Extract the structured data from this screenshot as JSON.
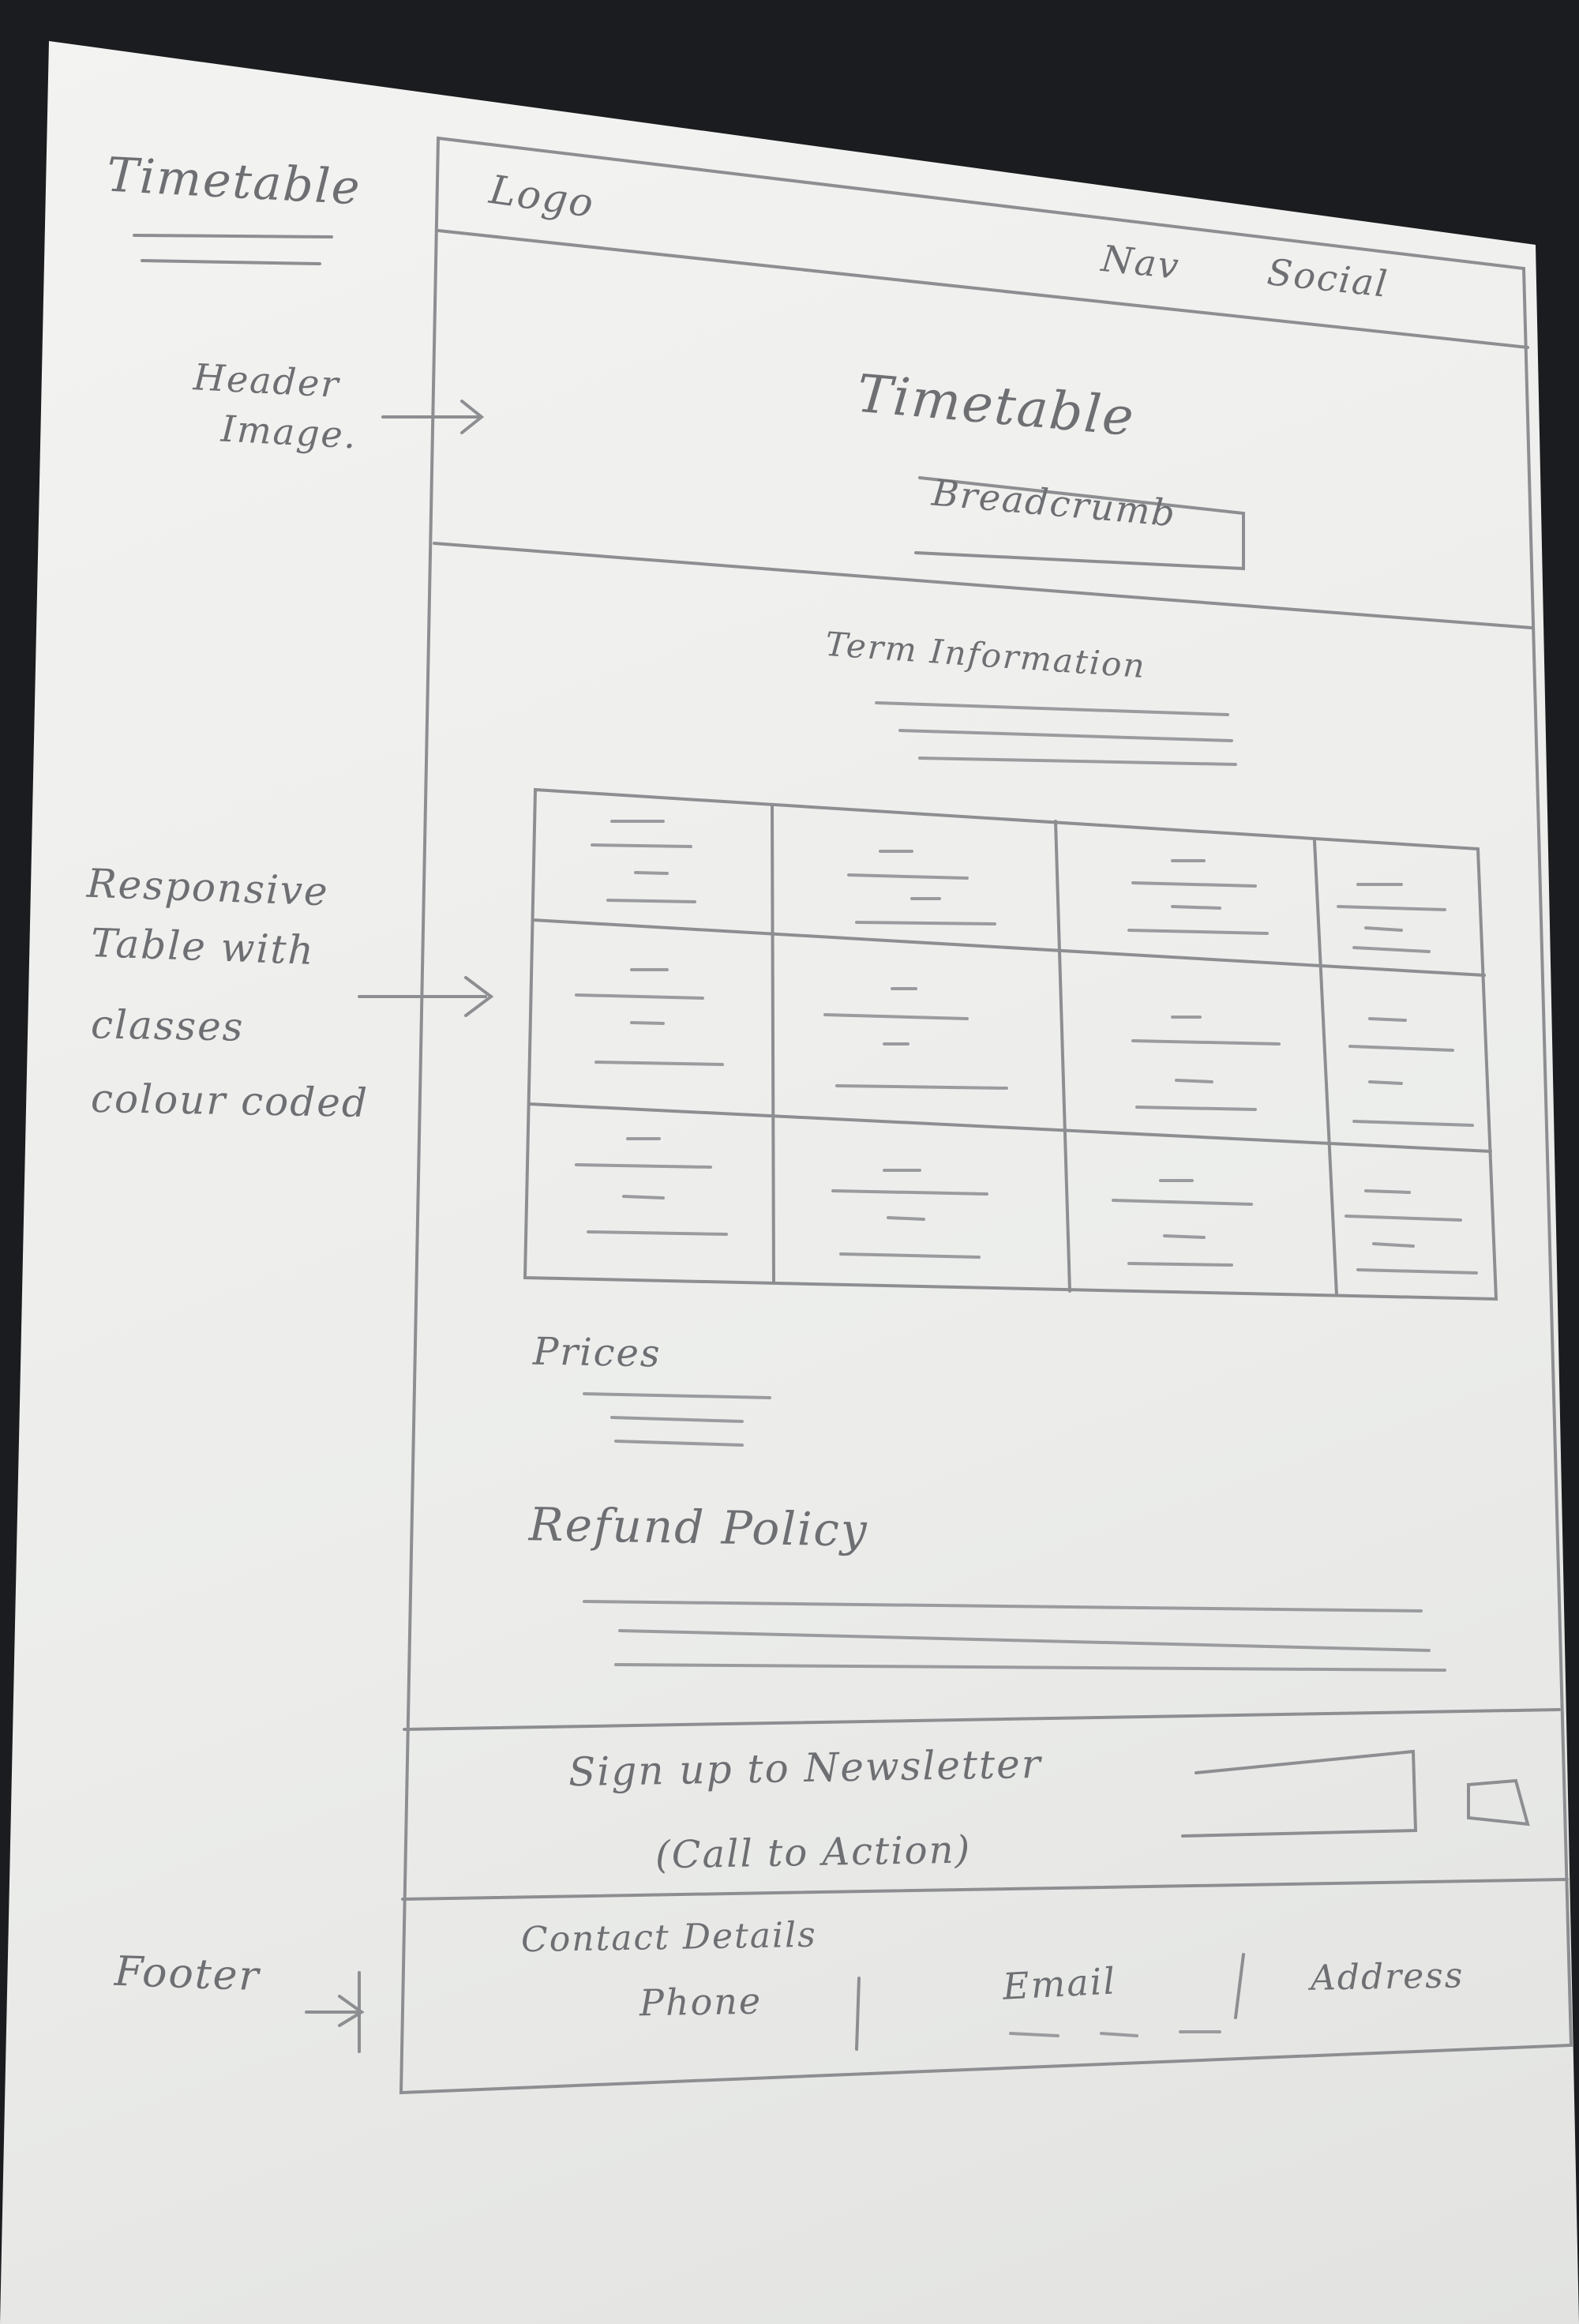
{
  "annotations": {
    "page_title": "Timetable",
    "header_image": "Header",
    "header_image_2": "Image.",
    "table_note": [
      "Responsive",
      "Table with",
      "classes",
      "colour coded"
    ],
    "footer": "Footer"
  },
  "wireframe": {
    "logo": "Logo",
    "nav": "Nav",
    "social": "Social",
    "hero_title": "Timetable",
    "breadcrumb": "Breadcrumb",
    "term_heading": "Term Information",
    "prices_heading": "Prices",
    "refund_heading": "Refund Policy",
    "newsletter_text": "Sign up to Newsletter",
    "newsletter_cta": "(Call to Action)",
    "contact_heading": "Contact Details",
    "contact_phone": "Phone",
    "contact_email": "Email",
    "contact_address": "Address"
  },
  "table": {
    "rows": 3,
    "columns": 4
  },
  "colors": {
    "pencil": "#8d8e91",
    "paper": "#efefed",
    "background": "#1b1c1f"
  }
}
